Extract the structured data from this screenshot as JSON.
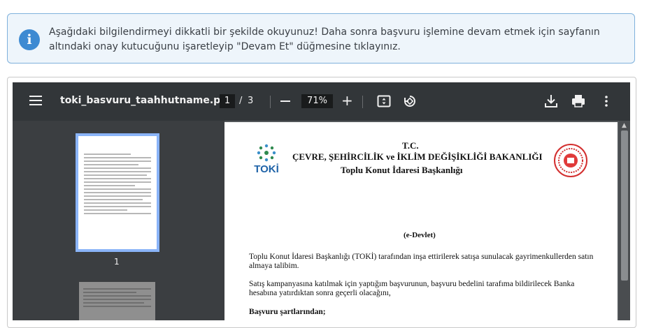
{
  "notice": {
    "text": "Aşağıdaki bilgilendirmeyi dikkatli bir şekilde okuyunuz! Daha sonra başvuru işlemine devam etmek için sayfanın altındaki onay kutucuğunu işaretleyip \"Devam Et\" düğmesine tıklayınız.",
    "icon": "info-icon",
    "accent_color": "#3d8ad2"
  },
  "viewer": {
    "filename": "toki_basvuru_taahhutname.pdf",
    "current_page": "1",
    "page_separator": "/",
    "total_pages": "3",
    "zoom": "71%",
    "thumbnail_label": "1",
    "icons": [
      "menu-icon",
      "zoom-out-icon",
      "zoom-in-icon",
      "fit-page-icon",
      "rotate-icon",
      "download-icon",
      "print-icon",
      "more-options-icon"
    ]
  },
  "document": {
    "header_line1": "T.C.",
    "header_line2": "ÇEVRE, ŞEHİRCİLİK ve İKLİM DEĞİŞİKLİĞİ BAKANLIĞI",
    "header_line3": "Toplu Konut İdaresi Başkanlığı",
    "logo_text": "TOKİ",
    "subtitle": "(e-Devlet)",
    "paragraph1": "Toplu Konut İdaresi Başkanlığı (TOKİ) tarafından inşa ettirilerek satışa sunulacak gayrimenkullerden satın almaya talibim.",
    "paragraph2": "Satış kampanyasına katılmak için yaptığım başvurunun, başvuru bedelini tarafıma bildirilecek Banka hesabına yatırdıktan sonra geçerli olacağını,",
    "section_title": "Başvuru şartlarından;"
  }
}
